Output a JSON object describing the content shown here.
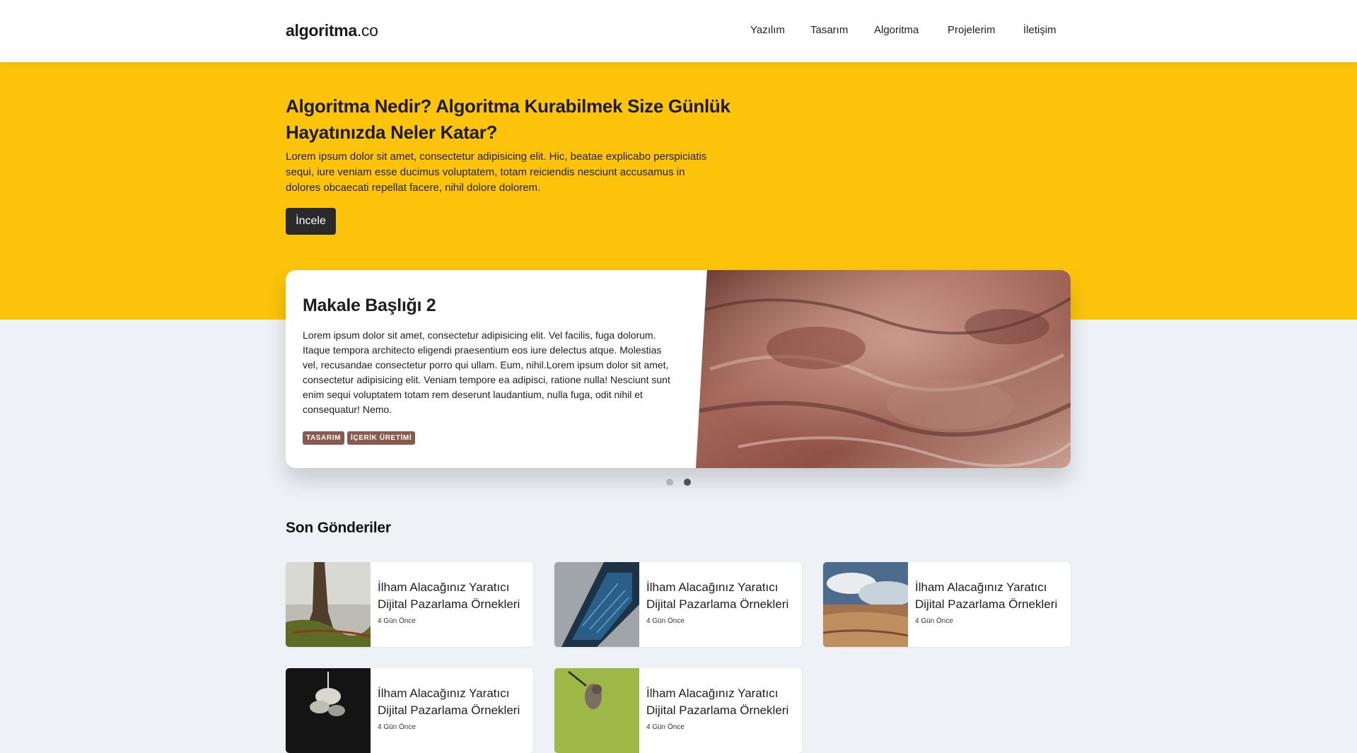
{
  "header": {
    "logo_main": "algoritma",
    "logo_tld": ".co",
    "nav": [
      "Yazılım",
      "Tasarım",
      "Algoritma",
      "Projelerim",
      "İletişim"
    ]
  },
  "hero": {
    "title": "Algoritma Nedir? Algoritma Kurabilmek Size Günlük Hayatınızda Neler Katar?",
    "text": "Lorem ipsum dolor sit amet, consectetur adipisicing elit. Hic, beatae explicabo perspiciatis sequi, iure veniam esse ducimus voluptatem, totam reiciendis nesciunt accusamus in dolores obcaecati repellat facere, nihil dolore dolorem.",
    "button_label": "İncele"
  },
  "featured": {
    "title": "Makale Başlığı 2",
    "text": "Lorem ipsum dolor sit amet, consectetur adipisicing elit. Vel facilis, fuga dolorum. Itaque tempora architecto eligendi praesentium eos iure delectus atque. Molestias vel, recusandae consectetur porro qui ullam. Eum, nihil.Lorem ipsum dolor sit amet, consectetur adipisicing elit. Veniam tempore ea adipisci, ratione nulla! Nesciunt sunt enim sequi voluptatem totam rem deserunt laudantium, nulla fuga, odit nihil et consequatur! Nemo.",
    "tags": [
      "TASARIM",
      "İÇERİK ÜRETİMİ"
    ],
    "image": "red-rock-landscape",
    "slides_total": 2,
    "active_slide": 2
  },
  "recent": {
    "title": "Son Gönderiler",
    "posts": [
      {
        "title": "İlham Alacağınız Yaratıcı Dijital Pazarlama Örnekleri",
        "time": "4 Gün Önce",
        "image": "forest-tree"
      },
      {
        "title": "İlham Alacağınız Yaratıcı Dijital Pazarlama Örnekleri",
        "time": "4 Gün Önce",
        "image": "laptop-code"
      },
      {
        "title": "İlham Alacağınız Yaratıcı Dijital Pazarlama Örnekleri",
        "time": "4 Gün Önce",
        "image": "desert-sky"
      },
      {
        "title": "İlham Alacağınız Yaratıcı Dijital Pazarlama Örnekleri",
        "time": "4 Gün Önce",
        "image": "dark-flower"
      },
      {
        "title": "İlham Alacağınız Yaratıcı Dijital Pazarlama Örnekleri",
        "time": "4 Gün Önce",
        "image": "hummingbird"
      }
    ]
  },
  "colors": {
    "accent": "#fdc40b",
    "background": "#eef2f6",
    "button": "#2a2a2a",
    "tag": "#8a5a4f"
  }
}
